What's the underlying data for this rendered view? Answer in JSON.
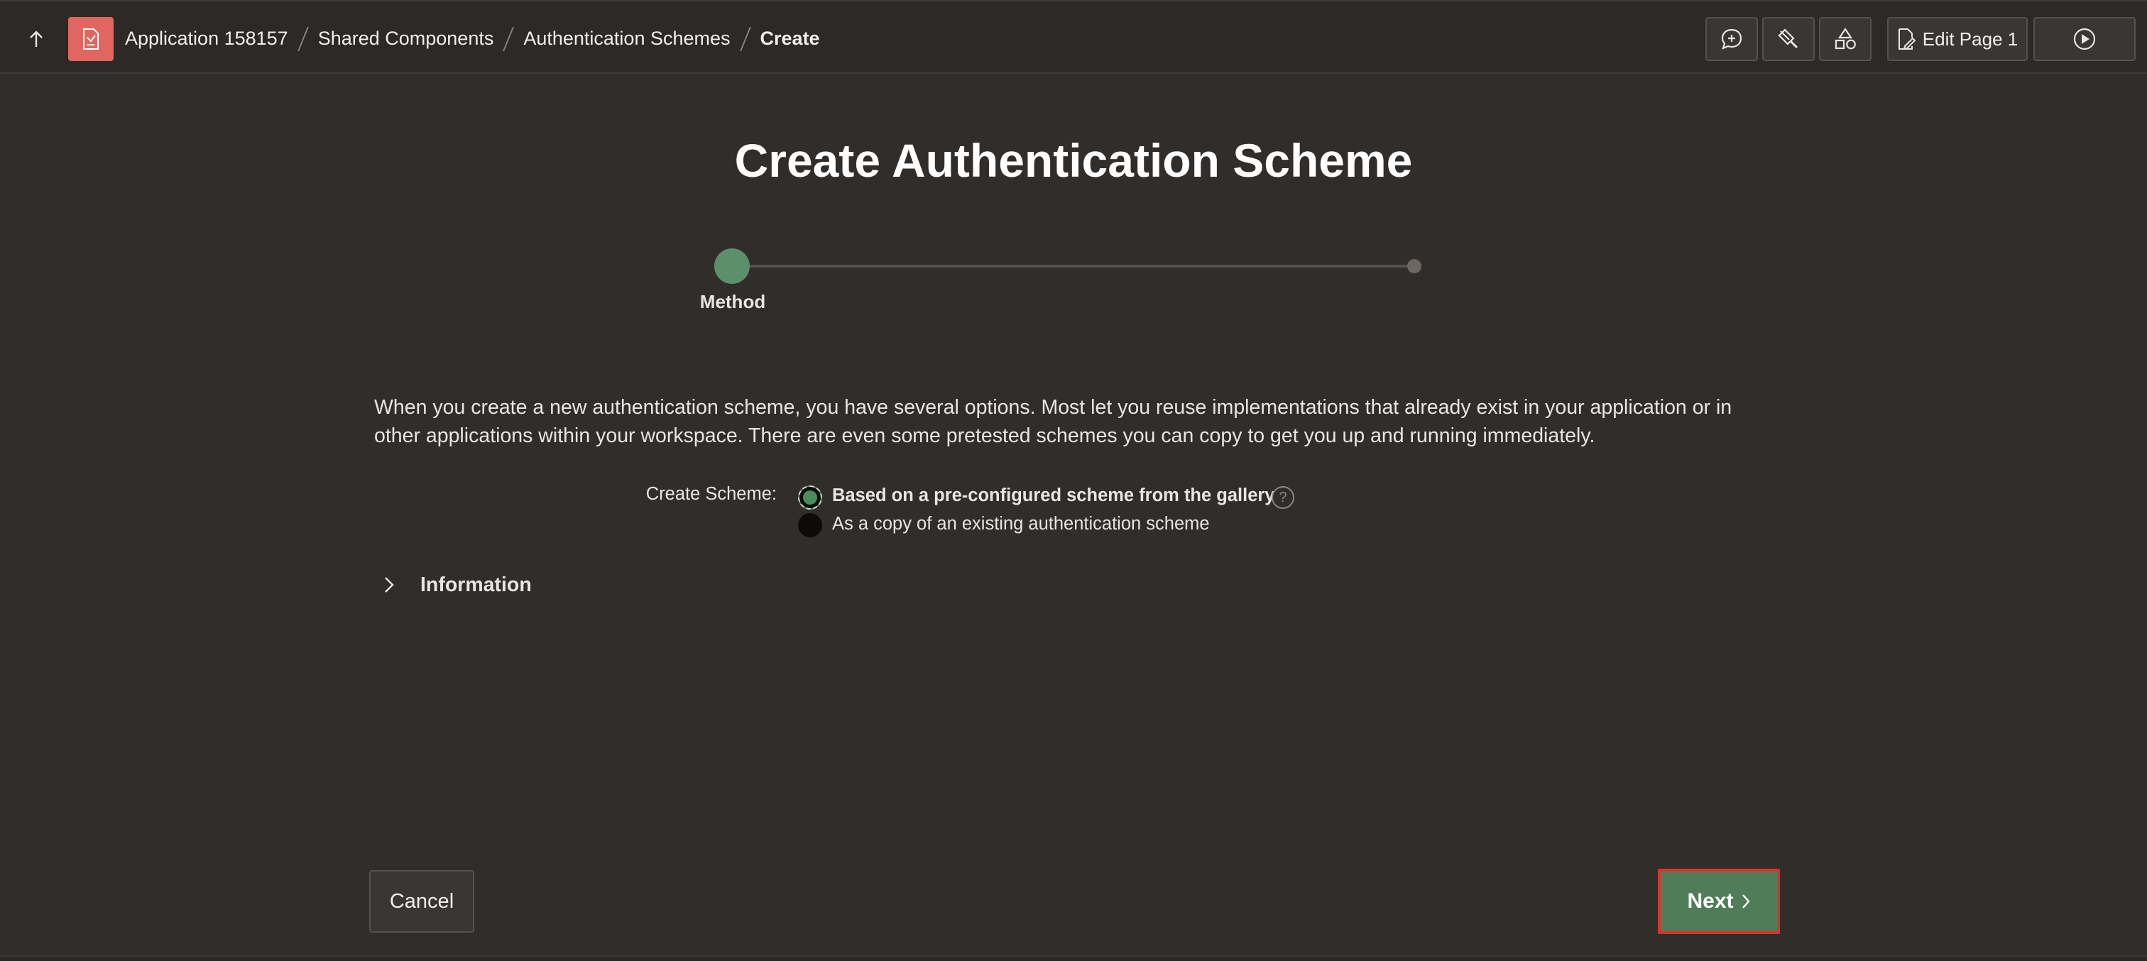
{
  "header": {
    "breadcrumbs": [
      {
        "label": "Application 158157"
      },
      {
        "label": "Shared Components"
      },
      {
        "label": "Authentication Schemes"
      },
      {
        "label": "Create"
      }
    ],
    "edit_page_label": "Edit Page 1",
    "icons": {
      "up": "arrow-up-icon",
      "app": "application-icon",
      "comment": "add-comment-icon",
      "shared": "brush-icon",
      "components": "shapes-icon",
      "edit": "edit-page-icon",
      "run": "run-play-icon"
    }
  },
  "page": {
    "title": "Create Authentication Scheme",
    "steps": [
      {
        "label": "Method",
        "active": true
      },
      {
        "label": "",
        "active": false
      }
    ],
    "intro": "When you create a new authentication scheme, you have several options. Most let you reuse implementations that already exist in your application or in other applications within your workspace. There are even some pretested schemes you can copy to get you up and running immediately.",
    "create_scheme": {
      "label": "Create Scheme:",
      "options": [
        {
          "label": "Based on a pre-configured scheme from the gallery",
          "selected": true
        },
        {
          "label": "As a copy of an existing authentication scheme",
          "selected": false
        }
      ],
      "help_glyph": "?"
    },
    "information_region": {
      "title": "Information",
      "collapsed": true
    }
  },
  "footer": {
    "cancel_label": "Cancel",
    "next_label": "Next"
  },
  "colors": {
    "background": "#312d2a",
    "accent_green": "#4f7d58",
    "app_icon": "#e1665f",
    "highlight_border": "#d6352c"
  }
}
